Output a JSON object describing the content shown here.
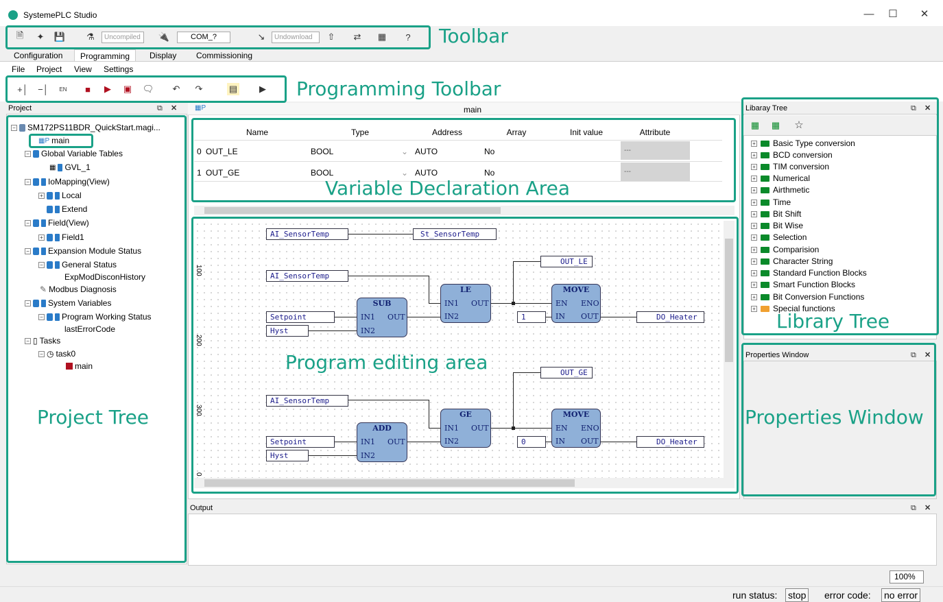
{
  "app": {
    "title": "SystemePLC Studio"
  },
  "toolbar": {
    "compile_status": "Uncompiled",
    "port": "COM_?",
    "download_status": "Undownload",
    "annotation": "Toolbar"
  },
  "tabs": [
    "Configuration",
    "Programming",
    "Display",
    "Commissioning"
  ],
  "menu": [
    "File",
    "Project",
    "View",
    "Settings"
  ],
  "programming_toolbar": {
    "annotation": "Programming Toolbar"
  },
  "project_panel": {
    "title": "Project",
    "annotation": "Project Tree",
    "items": [
      "SM172PS11BDR_QuickStart.magi...",
      "main",
      "Global Variable Tables",
      "GVL_1",
      "IoMapping(View)",
      "Local",
      "Extend",
      "Field(View)",
      "Field1",
      "Expansion Module Status",
      "General Status",
      "ExpModDisconHistory",
      "Modbus Diagnosis",
      "System Variables",
      "Program Working Status",
      "lastErrorCode",
      "Tasks",
      "task0",
      "main"
    ]
  },
  "editor": {
    "tab_title": "main",
    "var_annotation": "Variable Declaration Area",
    "prog_annotation": "Program editing area",
    "columns": [
      "Name",
      "Type",
      "Address",
      "Array",
      "Init value",
      "Attribute"
    ],
    "rows": [
      {
        "idx": "0",
        "name": "OUT_LE",
        "type": "BOOL",
        "address": "AUTO",
        "array": "No",
        "init": "",
        "attr": "---"
      },
      {
        "idx": "1",
        "name": "OUT_GE",
        "type": "BOOL",
        "address": "AUTO",
        "array": "No",
        "init": "",
        "attr": "---"
      }
    ],
    "rungs": [
      "100",
      "200",
      "300",
      "0"
    ],
    "labels": {
      "ai_temp": "AI_SensorTemp",
      "st_temp": "St_SensorTemp",
      "setpoint": "Setpoint",
      "hyst": "Hyst",
      "out_le": "OUT_LE",
      "out_ge": "OUT_GE",
      "do_heater": "DO_Heater",
      "const1": "1",
      "const0": "0"
    },
    "blocks": {
      "sub": "SUB",
      "add": "ADD",
      "le": "LE",
      "ge": "GE",
      "move": "MOVE",
      "in1": "IN1",
      "in2": "IN2",
      "out": "OUT",
      "en": "EN",
      "eno": "ENO",
      "in": "IN"
    }
  },
  "library": {
    "title": "Libaray Tree",
    "annotation": "Library Tree",
    "items": [
      "Basic Type conversion",
      "BCD conversion",
      "TIM conversion",
      "Numerical",
      "Airthmetic",
      "Time",
      "Bit Shift",
      "Bit Wise",
      "Selection",
      "Comparision",
      "Character String",
      "Standard Function Blocks",
      "Smart Function Blocks",
      "Bit Conversion Functions",
      "Special functions"
    ]
  },
  "properties": {
    "title": "Properties Window",
    "annotation": "Properties Window"
  },
  "output": {
    "title": "Output"
  },
  "status": {
    "zoom": "100%",
    "run_label": "run status:",
    "run_value": "stop",
    "error_label": "error code:",
    "error_value": "no error"
  },
  "colors": {
    "accent": "#1aa187",
    "block_fill": "#8fb0d8"
  }
}
